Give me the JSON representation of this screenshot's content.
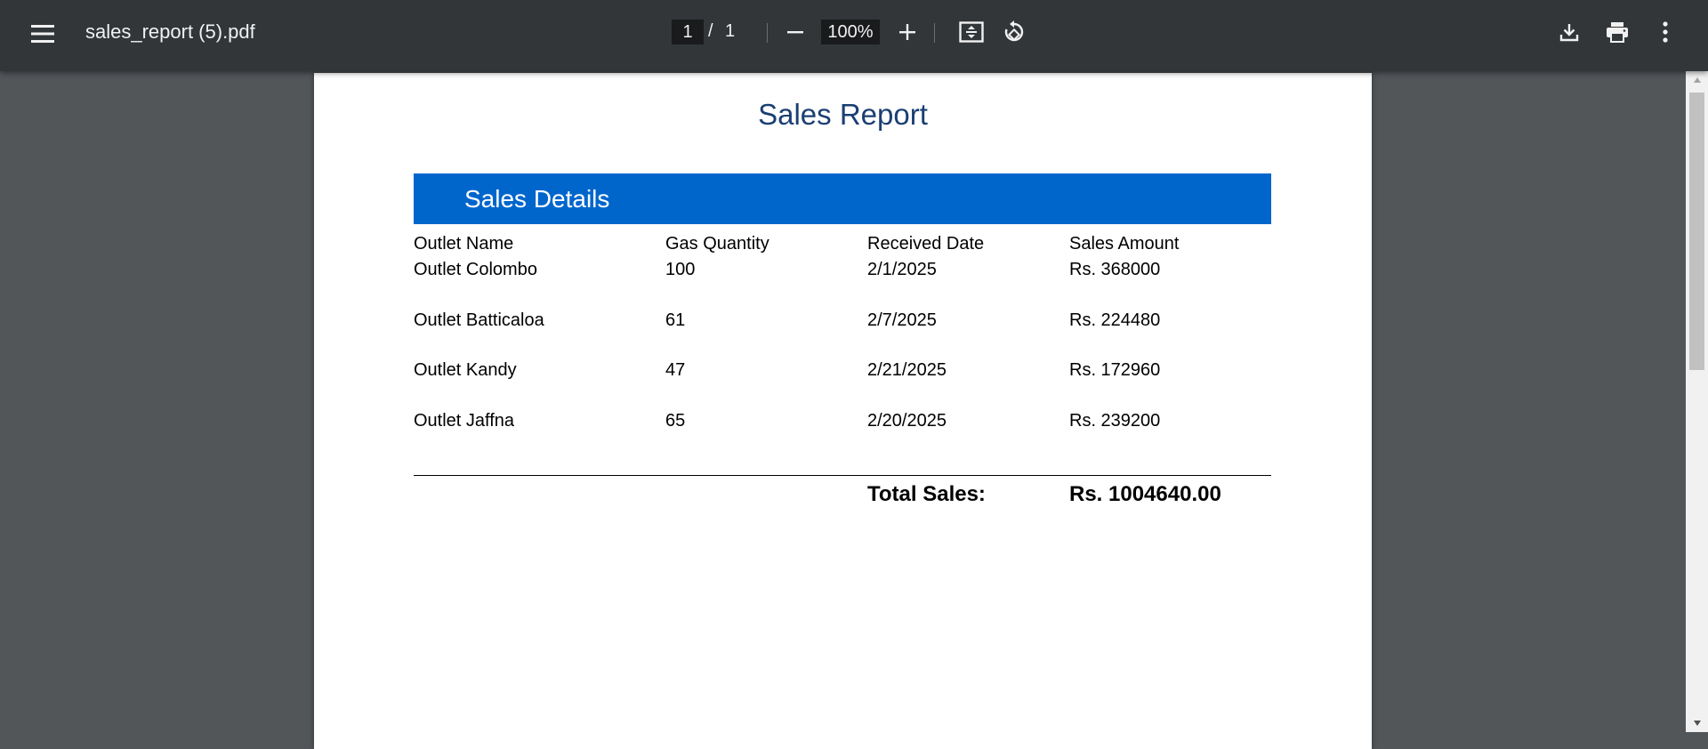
{
  "toolbar": {
    "file_name": "sales_report (5).pdf",
    "page_current": "1",
    "page_separator": "/",
    "page_total": "1",
    "zoom_level": "100%"
  },
  "icons": {
    "menu": "menu-icon",
    "zoom_out": "minus-icon",
    "zoom_in": "plus-icon",
    "fit": "fit-to-page-icon",
    "rotate": "rotate-icon",
    "download": "download-icon",
    "print": "print-icon",
    "more": "more-vertical-icon"
  },
  "colors": {
    "toolbar_bg": "#323639",
    "viewer_bg": "#525659",
    "section_header_bg": "#0066cc",
    "title_color": "#1a3f73"
  },
  "document": {
    "title": "Sales Report",
    "section_title": "Sales Details",
    "columns": [
      "Outlet Name",
      "Gas Quantity",
      "Received Date",
      "Sales Amount"
    ],
    "rows": [
      [
        "Outlet Colombo",
        "100",
        "2/1/2025",
        "Rs. 368000"
      ],
      [
        "Outlet Batticaloa",
        "61",
        "2/7/2025",
        "Rs. 224480"
      ],
      [
        "Outlet Kandy",
        "47",
        "2/21/2025",
        "Rs. 172960"
      ],
      [
        "Outlet Jaffna",
        "65",
        "2/20/2025",
        "Rs. 239200"
      ]
    ],
    "total_label": "Total Sales:",
    "total_value": "Rs. 1004640.00"
  }
}
